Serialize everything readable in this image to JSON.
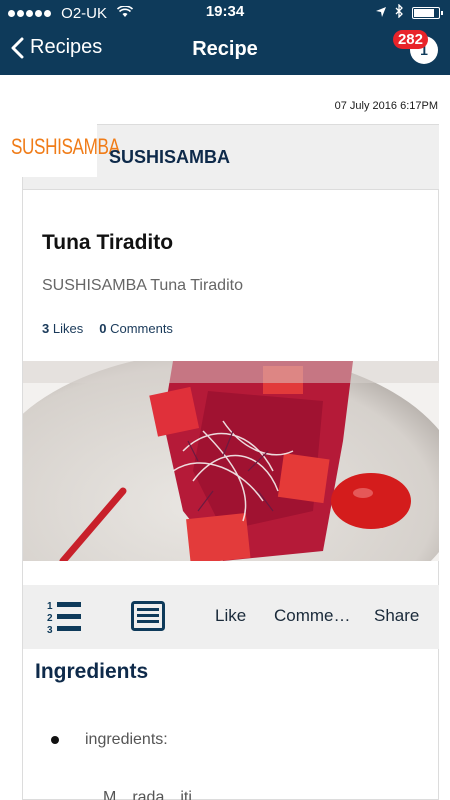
{
  "status": {
    "carrier": "O2-UK",
    "time": "19:34",
    "battery_level": 0.85
  },
  "nav": {
    "back_label": "Recipes",
    "title": "Recipe",
    "notification_count": "282"
  },
  "post": {
    "date": "07 July 2016 6:17PM",
    "brand_logo_text": "SUSHISAMBA",
    "brand_name": "SUSHISAMBA",
    "title": "Tuna Tiradito",
    "subtitle": "SUSHISAMBA Tuna Tiradito",
    "likes_count": "3",
    "likes_label": "Likes",
    "comments_count": "0",
    "comments_label": "Comments"
  },
  "actions": {
    "like": "Like",
    "comment": "Comme…",
    "share": "Share"
  },
  "ingredients": {
    "title": "Ingredients",
    "items": [
      "ingredients:"
    ],
    "next_item_partial": "M…rada…iti…"
  },
  "colors": {
    "nav_bg": "#0e3a5a",
    "badge": "#e8232a",
    "logo": "#f07c18"
  },
  "icons": [
    "chevron-left-icon",
    "wifi-icon",
    "location-arrow-icon",
    "bluetooth-icon",
    "battery-icon",
    "notification-icon",
    "numbered-list-icon",
    "recipe-card-icon"
  ]
}
